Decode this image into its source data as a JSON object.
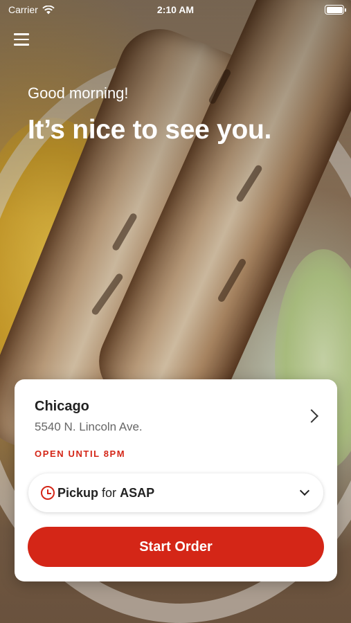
{
  "status_bar": {
    "carrier": "Carrier",
    "time": "2:10 AM"
  },
  "hero": {
    "greeting": "Good morning!",
    "headline": "It’s nice to see you."
  },
  "location": {
    "city": "Chicago",
    "address": "5540 N. Lincoln Ave.",
    "hours": "OPEN UNTIL 8PM"
  },
  "order_mode": {
    "mode": "Pickup",
    "connector": "for",
    "time": "ASAP"
  },
  "start_button": {
    "label": "Start Order"
  },
  "colors": {
    "accent": "#d42617",
    "card_bg": "#ffffff",
    "text_dark": "#222222",
    "text_muted": "#666666"
  },
  "icons": [
    "wifi-icon",
    "battery-icon",
    "menu-icon",
    "chevron-right-icon",
    "clock-icon",
    "chevron-down-icon"
  ]
}
